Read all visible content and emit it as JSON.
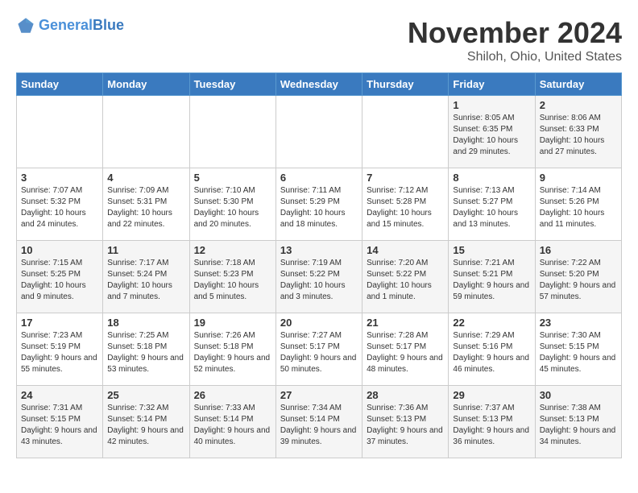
{
  "header": {
    "logo_line1": "General",
    "logo_line2": "Blue",
    "month": "November 2024",
    "location": "Shiloh, Ohio, United States"
  },
  "days_of_week": [
    "Sunday",
    "Monday",
    "Tuesday",
    "Wednesday",
    "Thursday",
    "Friday",
    "Saturday"
  ],
  "weeks": [
    [
      {
        "day": "",
        "info": ""
      },
      {
        "day": "",
        "info": ""
      },
      {
        "day": "",
        "info": ""
      },
      {
        "day": "",
        "info": ""
      },
      {
        "day": "",
        "info": ""
      },
      {
        "day": "1",
        "info": "Sunrise: 8:05 AM\nSunset: 6:35 PM\nDaylight: 10 hours and 29 minutes."
      },
      {
        "day": "2",
        "info": "Sunrise: 8:06 AM\nSunset: 6:33 PM\nDaylight: 10 hours and 27 minutes."
      }
    ],
    [
      {
        "day": "3",
        "info": "Sunrise: 7:07 AM\nSunset: 5:32 PM\nDaylight: 10 hours and 24 minutes."
      },
      {
        "day": "4",
        "info": "Sunrise: 7:09 AM\nSunset: 5:31 PM\nDaylight: 10 hours and 22 minutes."
      },
      {
        "day": "5",
        "info": "Sunrise: 7:10 AM\nSunset: 5:30 PM\nDaylight: 10 hours and 20 minutes."
      },
      {
        "day": "6",
        "info": "Sunrise: 7:11 AM\nSunset: 5:29 PM\nDaylight: 10 hours and 18 minutes."
      },
      {
        "day": "7",
        "info": "Sunrise: 7:12 AM\nSunset: 5:28 PM\nDaylight: 10 hours and 15 minutes."
      },
      {
        "day": "8",
        "info": "Sunrise: 7:13 AM\nSunset: 5:27 PM\nDaylight: 10 hours and 13 minutes."
      },
      {
        "day": "9",
        "info": "Sunrise: 7:14 AM\nSunset: 5:26 PM\nDaylight: 10 hours and 11 minutes."
      }
    ],
    [
      {
        "day": "10",
        "info": "Sunrise: 7:15 AM\nSunset: 5:25 PM\nDaylight: 10 hours and 9 minutes."
      },
      {
        "day": "11",
        "info": "Sunrise: 7:17 AM\nSunset: 5:24 PM\nDaylight: 10 hours and 7 minutes."
      },
      {
        "day": "12",
        "info": "Sunrise: 7:18 AM\nSunset: 5:23 PM\nDaylight: 10 hours and 5 minutes."
      },
      {
        "day": "13",
        "info": "Sunrise: 7:19 AM\nSunset: 5:22 PM\nDaylight: 10 hours and 3 minutes."
      },
      {
        "day": "14",
        "info": "Sunrise: 7:20 AM\nSunset: 5:22 PM\nDaylight: 10 hours and 1 minute."
      },
      {
        "day": "15",
        "info": "Sunrise: 7:21 AM\nSunset: 5:21 PM\nDaylight: 9 hours and 59 minutes."
      },
      {
        "day": "16",
        "info": "Sunrise: 7:22 AM\nSunset: 5:20 PM\nDaylight: 9 hours and 57 minutes."
      }
    ],
    [
      {
        "day": "17",
        "info": "Sunrise: 7:23 AM\nSunset: 5:19 PM\nDaylight: 9 hours and 55 minutes."
      },
      {
        "day": "18",
        "info": "Sunrise: 7:25 AM\nSunset: 5:18 PM\nDaylight: 9 hours and 53 minutes."
      },
      {
        "day": "19",
        "info": "Sunrise: 7:26 AM\nSunset: 5:18 PM\nDaylight: 9 hours and 52 minutes."
      },
      {
        "day": "20",
        "info": "Sunrise: 7:27 AM\nSunset: 5:17 PM\nDaylight: 9 hours and 50 minutes."
      },
      {
        "day": "21",
        "info": "Sunrise: 7:28 AM\nSunset: 5:17 PM\nDaylight: 9 hours and 48 minutes."
      },
      {
        "day": "22",
        "info": "Sunrise: 7:29 AM\nSunset: 5:16 PM\nDaylight: 9 hours and 46 minutes."
      },
      {
        "day": "23",
        "info": "Sunrise: 7:30 AM\nSunset: 5:15 PM\nDaylight: 9 hours and 45 minutes."
      }
    ],
    [
      {
        "day": "24",
        "info": "Sunrise: 7:31 AM\nSunset: 5:15 PM\nDaylight: 9 hours and 43 minutes."
      },
      {
        "day": "25",
        "info": "Sunrise: 7:32 AM\nSunset: 5:14 PM\nDaylight: 9 hours and 42 minutes."
      },
      {
        "day": "26",
        "info": "Sunrise: 7:33 AM\nSunset: 5:14 PM\nDaylight: 9 hours and 40 minutes."
      },
      {
        "day": "27",
        "info": "Sunrise: 7:34 AM\nSunset: 5:14 PM\nDaylight: 9 hours and 39 minutes."
      },
      {
        "day": "28",
        "info": "Sunrise: 7:36 AM\nSunset: 5:13 PM\nDaylight: 9 hours and 37 minutes."
      },
      {
        "day": "29",
        "info": "Sunrise: 7:37 AM\nSunset: 5:13 PM\nDaylight: 9 hours and 36 minutes."
      },
      {
        "day": "30",
        "info": "Sunrise: 7:38 AM\nSunset: 5:13 PM\nDaylight: 9 hours and 34 minutes."
      }
    ]
  ]
}
